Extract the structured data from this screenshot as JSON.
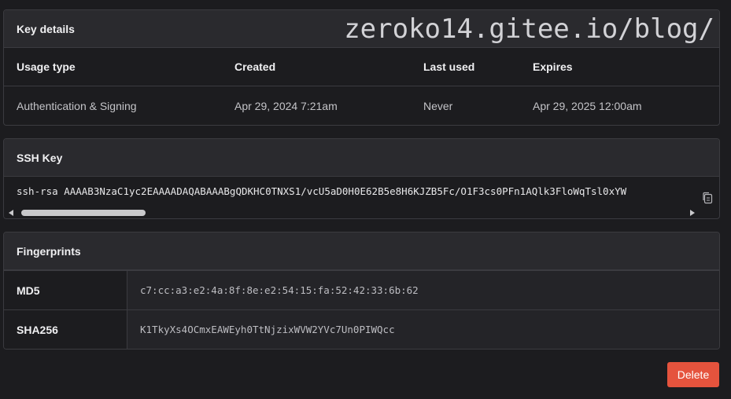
{
  "key_details": {
    "title": "Key details",
    "watermark": "zeroko14.gitee.io/blog/",
    "headers": [
      "Usage type",
      "Created",
      "Last used",
      "Expires"
    ],
    "values": [
      "Authentication & Signing",
      "Apr 29, 2024 7:21am",
      "Never",
      "Apr 29, 2025 12:00am"
    ]
  },
  "ssh_key": {
    "title": "SSH Key",
    "value": "ssh-rsa AAAAB3NzaC1yc2EAAAADAQABAAABgQDKHC0TNXS1/vcU5aD0H0E62B5e8H6KJZB5Fc/O1F3cs0PFn1AQlk3FloWqTsl0xYW",
    "copy_icon": "copy-icon",
    "scroll_fraction": 0.18
  },
  "fingerprints": {
    "title": "Fingerprints",
    "rows": [
      {
        "label": "MD5",
        "value": "c7:cc:a3:e2:4a:8f:8e:e2:54:15:fa:52:42:33:6b:62"
      },
      {
        "label": "SHA256",
        "value": "K1TkyXs4OCmxEAWEyh0TtNjzixWVW2YVc7Un0PIWQcc"
      }
    ]
  },
  "actions": {
    "delete_label": "Delete",
    "delete_color": "#e5533d"
  }
}
